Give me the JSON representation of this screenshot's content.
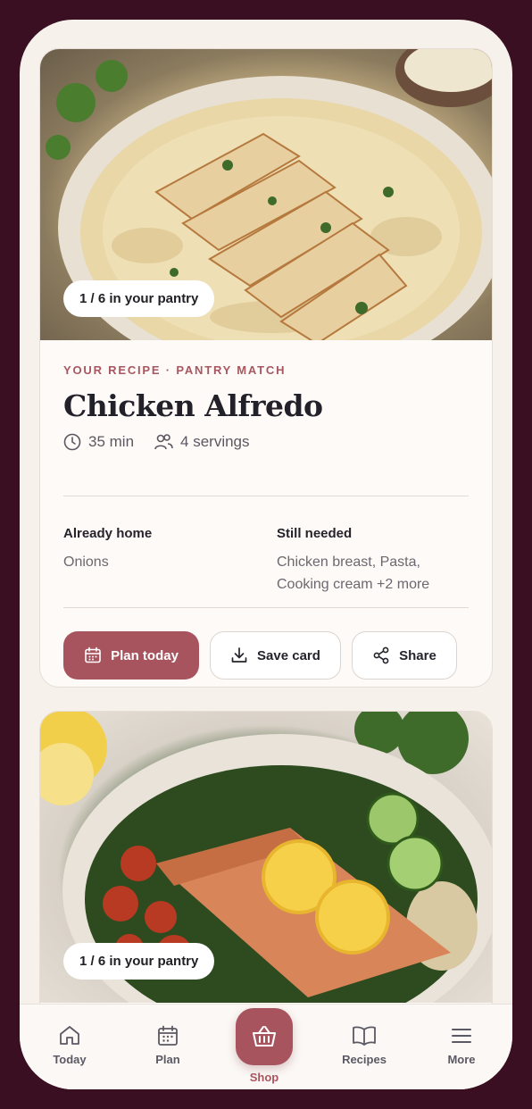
{
  "cards": [
    {
      "pantry_chip": "1 / 6 in your pantry",
      "kicker": "YOUR RECIPE · PANTRY MATCH",
      "title": "Chicken Alfredo",
      "time": "35 min",
      "servings": "4 servings",
      "already_home_label": "Already home",
      "already_home": "Onions",
      "still_needed_label": "Still needed",
      "still_needed": "Chicken breast, Pasta, Cooking cream +2 more",
      "actions": {
        "plan": "Plan today",
        "save": "Save card",
        "share": "Share"
      }
    },
    {
      "pantry_chip": "1 / 6 in your pantry"
    }
  ],
  "tabbar": {
    "today": "Today",
    "plan": "Plan",
    "shop": "Shop",
    "recipes": "Recipes",
    "more": "More"
  },
  "colors": {
    "accent": "#a8545f",
    "frame": "#3a0f22",
    "background": "#f7f1ec"
  }
}
